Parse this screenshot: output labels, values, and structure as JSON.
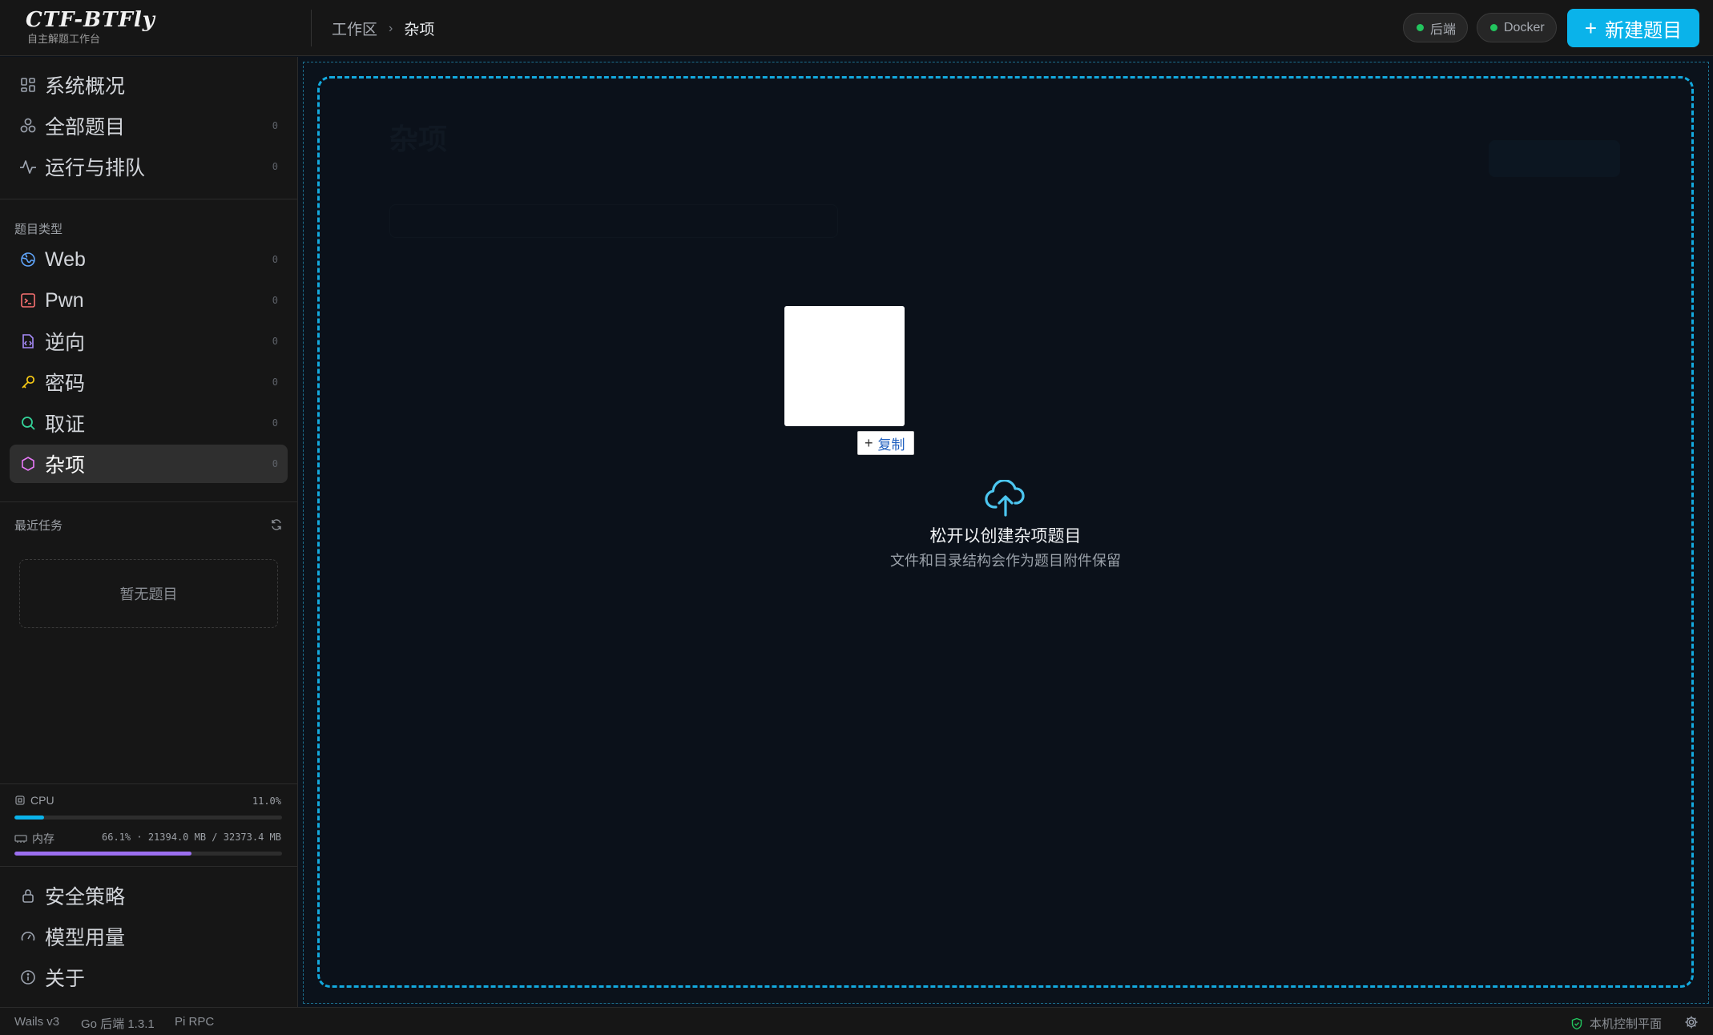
{
  "app": {
    "title": "CTF-BTFly",
    "subtitle": "自主解题工作台"
  },
  "breadcrumb": [
    "工作区",
    "杂项"
  ],
  "header": {
    "status_backend": "后端",
    "status_docker": "Docker",
    "new_challenge": "新建题目",
    "status_color": "#22c55e",
    "accent": "#0ab3ea"
  },
  "sidebar": {
    "top_items": [
      {
        "label": "系统概况",
        "icon": "dashboard-icon"
      },
      {
        "label": "全部题目",
        "count": "0",
        "icon": "boxes-icon"
      },
      {
        "label": "运行与排队",
        "count": "0",
        "icon": "activity-icon"
      }
    ],
    "categories_title": "题目类型",
    "categories": [
      {
        "label": "Web",
        "count": "0",
        "icon": "globe-icon",
        "color": "#60a5fa"
      },
      {
        "label": "Pwn",
        "count": "0",
        "icon": "terminal-icon",
        "color": "#f87171"
      },
      {
        "label": "逆向",
        "count": "0",
        "icon": "file-code-icon",
        "color": "#a78bfa"
      },
      {
        "label": "密码",
        "count": "0",
        "icon": "key-icon",
        "color": "#facc15"
      },
      {
        "label": "取证",
        "count": "0",
        "icon": "search-icon",
        "color": "#34d399"
      },
      {
        "label": "杂项",
        "count": "0",
        "icon": "hexagon-icon",
        "color": "#e879f9",
        "active": true
      }
    ],
    "recent_title": "最近任务",
    "recent_empty": "暂无题目",
    "cpu": {
      "label": "CPU",
      "value": "11.0%",
      "percent": 11.0
    },
    "memory": {
      "label": "内存",
      "value": "66.1% · 21394.0 MB / 32373.4 MB",
      "percent": 66.1
    },
    "bottom_items": [
      {
        "label": "安全策略",
        "icon": "lock-icon"
      },
      {
        "label": "模型用量",
        "icon": "gauge-icon"
      },
      {
        "label": "关于",
        "icon": "info-icon"
      }
    ]
  },
  "statusbar": {
    "items": [
      "Wails v3",
      "Go 后端 1.3.1",
      "Pi RPC"
    ],
    "right": "本机控制平面"
  },
  "dropzone": {
    "title": "松开以创建杂项题目",
    "description": "文件和目录结构会作为题目附件保留",
    "copy_label": "复制"
  }
}
